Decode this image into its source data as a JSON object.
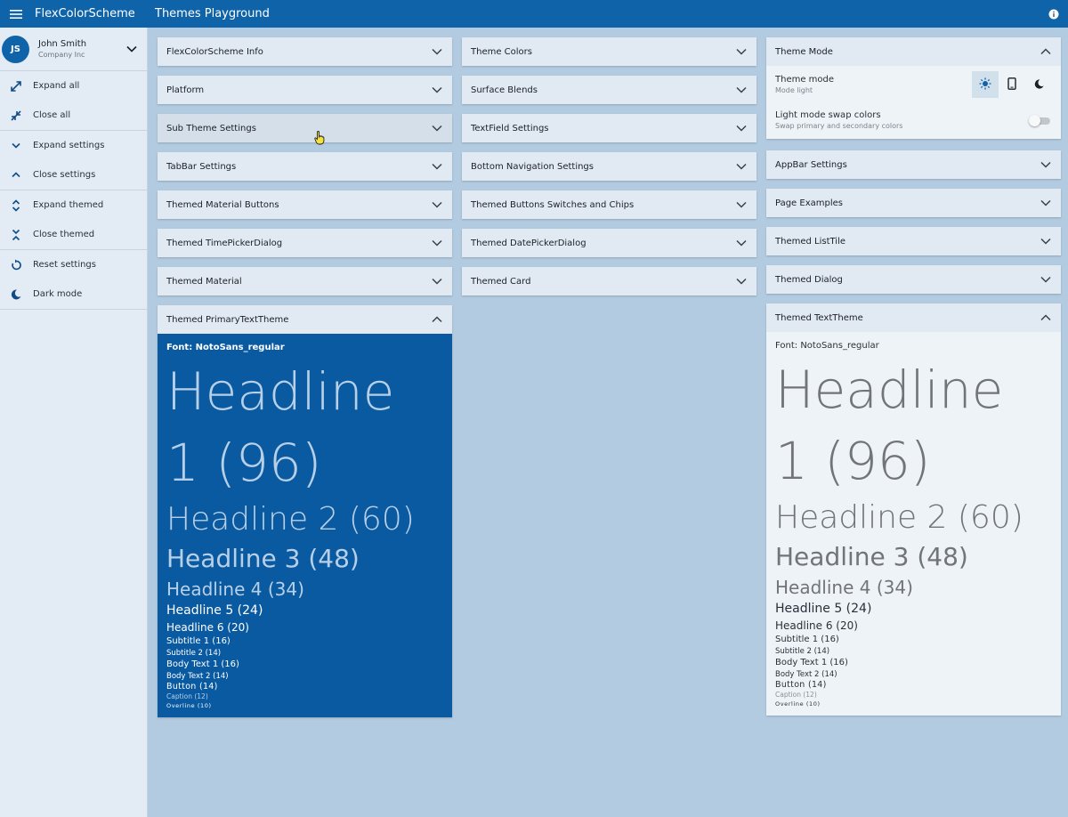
{
  "appbar": {
    "brand": "FlexColorScheme",
    "title": "Themes Playground"
  },
  "user": {
    "initials": "JS",
    "name": "John Smith",
    "company": "Company Inc"
  },
  "sidebar": {
    "items": [
      {
        "label": "Expand all",
        "icon": "expand-all-icon"
      },
      {
        "label": "Close all",
        "icon": "close-all-icon"
      },
      {
        "label": "Expand settings",
        "icon": "chevron-down-icon"
      },
      {
        "label": "Close settings",
        "icon": "chevron-up-icon"
      },
      {
        "label": "Expand themed",
        "icon": "unfold-more-icon"
      },
      {
        "label": "Close themed",
        "icon": "unfold-less-icon"
      },
      {
        "label": "Reset settings",
        "icon": "reset-icon"
      },
      {
        "label": "Dark mode",
        "icon": "moon-icon"
      }
    ]
  },
  "col1": [
    "FlexColorScheme Info",
    "Platform",
    "Sub Theme Settings",
    "TabBar Settings",
    "Themed Material Buttons",
    "Themed TimePickerDialog",
    "Themed Material",
    "Themed PrimaryTextTheme"
  ],
  "col2": [
    "Theme Colors",
    "Surface Blends",
    "TextField Settings",
    "Bottom Navigation Settings",
    "Themed Buttons Switches and Chips",
    "Themed DatePickerDialog",
    "Themed Card"
  ],
  "col3": [
    "Theme Mode",
    "AppBar Settings",
    "Page Examples",
    "Themed ListTile",
    "Themed Dialog",
    "Themed TextTheme"
  ],
  "theme_mode": {
    "label": "Theme mode",
    "sub": "Mode light",
    "swap_label": "Light mode swap colors",
    "swap_sub": "Swap primary and secondary colors",
    "selected": "light"
  },
  "text_theme": {
    "font": "Font: NotoSans_regular",
    "h1": "Headline 1 (96)",
    "h2": "Headline 2 (60)",
    "h3": "Headline 3 (48)",
    "h4": "Headline 4 (34)",
    "h5": "Headline 5 (24)",
    "h6": "Headline 6 (20)",
    "s1": "Subtitle 1 (16)",
    "s2": "Subtitle 2 (14)",
    "b1": "Body Text 1 (16)",
    "b2": "Body Text 2 (14)",
    "btn": "Button (14)",
    "cap": "Caption (12)",
    "ovl": "Overline (10)"
  },
  "colors": {
    "primary": "#0f63a8",
    "primary_panel": "#0a5aa1",
    "background": "#b2cbe0"
  }
}
